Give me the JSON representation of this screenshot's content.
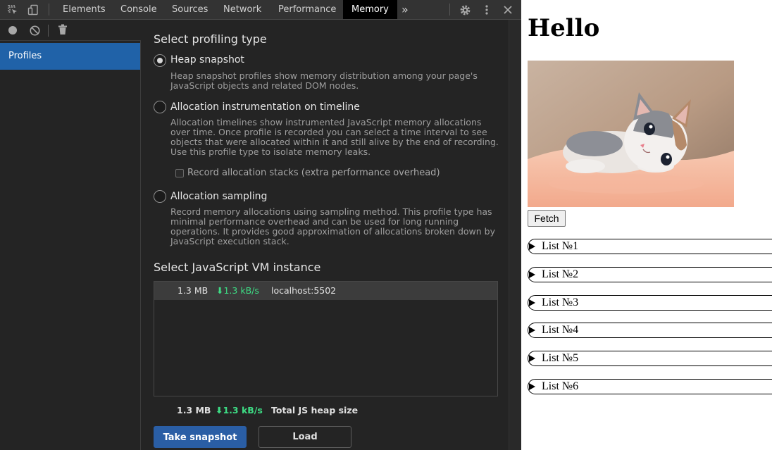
{
  "devtools": {
    "tabs": [
      "Elements",
      "Console",
      "Sources",
      "Network",
      "Performance",
      "Memory"
    ],
    "active_tab": "Memory",
    "more_tabs_glyph": "»",
    "sidebar": {
      "items": [
        {
          "label": "Profiles"
        }
      ]
    },
    "profiling": {
      "title": "Select profiling type",
      "options": [
        {
          "label": "Heap snapshot",
          "description": "Heap snapshot profiles show memory distribution among your page's JavaScript objects and related DOM nodes.",
          "checked": true
        },
        {
          "label": "Allocation instrumentation on timeline",
          "description": "Allocation timelines show instrumented JavaScript memory allocations over time. Once profile is recorded you can select a time interval to see objects that were allocated within it and still alive by the end of recording. Use this profile type to isolate memory leaks.",
          "checked": false
        },
        {
          "label": "Allocation sampling",
          "description": "Record memory allocations using sampling method. This profile type has minimal performance overhead and can be used for long running operations. It provides good approximation of allocations broken down by JavaScript execution stack.",
          "checked": false
        }
      ],
      "record_stacks_label": "Record allocation stacks (extra performance overhead)"
    },
    "vm": {
      "title": "Select JavaScript VM instance",
      "instances": [
        {
          "size": "1.3 MB",
          "rate": "⬇1.3 kB/s",
          "url": "localhost:5502"
        }
      ]
    },
    "footer": {
      "size": "1.3 MB",
      "rate": "⬇1.3 kB/s",
      "label": "Total JS heap size"
    },
    "buttons": {
      "take_snapshot": "Take snapshot",
      "load": "Load"
    },
    "colors": {
      "accent": "#2a5ea5",
      "selected": "#2062a8",
      "rate_green": "#3ddc84",
      "background": "#242424"
    }
  },
  "page": {
    "heading": "Hello",
    "fetch_label": "Fetch",
    "lists": [
      "List №1",
      "List №2",
      "List №3",
      "List №4",
      "List №5",
      "List №6"
    ]
  }
}
